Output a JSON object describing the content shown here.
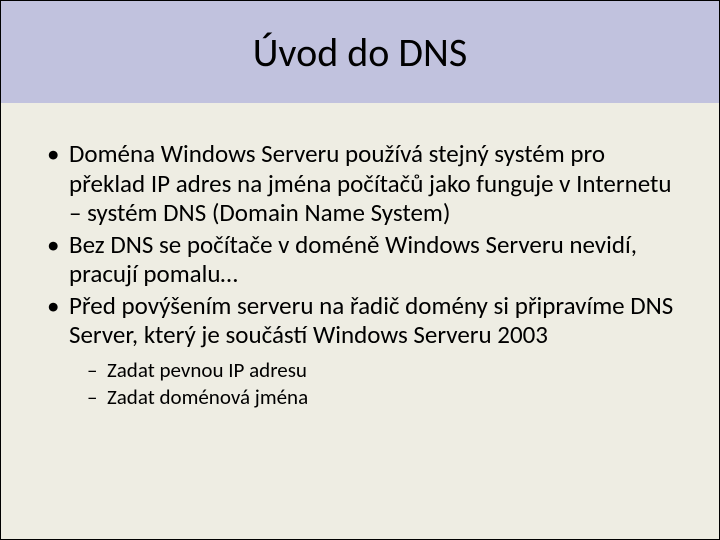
{
  "slide": {
    "title": "Úvod do DNS",
    "bullets": [
      {
        "text": "Doména Windows Serveru používá stejný systém pro překlad IP adres na jména počítačů jako funguje v Internetu – systém DNS (Domain Name System)"
      },
      {
        "text": "Bez DNS se počítače v doméně Windows Serveru nevidí, pracují pomalu…"
      },
      {
        "text": "Před povýšením serveru na řadič domény si připravíme DNS Server, který je součástí Windows Serveru 2003",
        "sub": [
          "Zadat pevnou IP adresu",
          "Zadat doménová jména"
        ]
      }
    ]
  }
}
